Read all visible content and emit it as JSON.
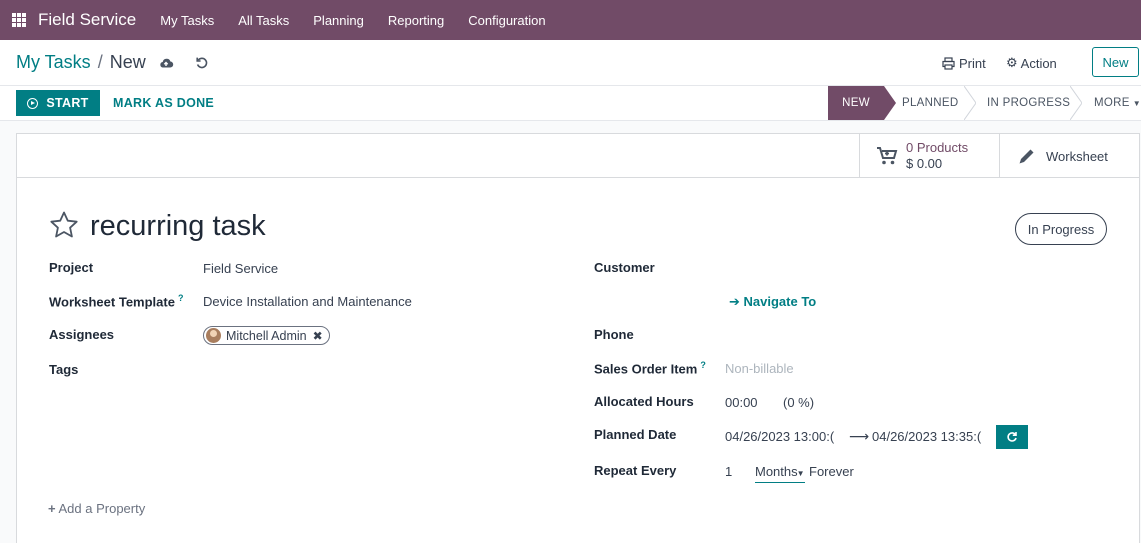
{
  "topnav": {
    "brand": "Field Service",
    "items": [
      "My Tasks",
      "All Tasks",
      "Planning",
      "Reporting",
      "Configuration"
    ]
  },
  "breadcrumb": {
    "parent": "My Tasks",
    "separator": "/",
    "current": "New"
  },
  "controls": {
    "print": "Print",
    "action": "Action",
    "new": "New"
  },
  "statusbar": {
    "start": "START",
    "mark_done": "MARK AS DONE",
    "stages": [
      "NEW",
      "PLANNED",
      "IN PROGRESS",
      "MORE"
    ],
    "active_stage": "NEW"
  },
  "smart_buttons": {
    "products_count": "0 Products",
    "products_amount": "$ 0.00",
    "worksheet": "Worksheet"
  },
  "task": {
    "title": "recurring task",
    "status": "In Progress"
  },
  "fields_left": {
    "project_label": "Project",
    "project_value": "Field Service",
    "worksheet_label": "Worksheet Template",
    "worksheet_help": "?",
    "worksheet_value": "Device Installation and Maintenance",
    "assignees_label": "Assignees",
    "assignee": "Mitchell Admin",
    "tags_label": "Tags",
    "add_property": "Add a Property"
  },
  "fields_right": {
    "customer_label": "Customer",
    "navigate": "Navigate To",
    "phone_label": "Phone",
    "sol_label": "Sales Order Item",
    "sol_help": "?",
    "sol_placeholder": "Non-billable",
    "hours_label": "Allocated Hours",
    "hours_value": "00:00",
    "hours_percent": "(0 %)",
    "planned_label": "Planned Date",
    "planned_start": "04/26/2023 13:00:(",
    "planned_end": "04/26/2023 13:35:(",
    "repeat_label": "Repeat Every",
    "repeat_interval": "1",
    "repeat_unit": "Months",
    "repeat_until": "Forever"
  },
  "colors": {
    "brand": "#714b67",
    "accent": "#017e84"
  }
}
